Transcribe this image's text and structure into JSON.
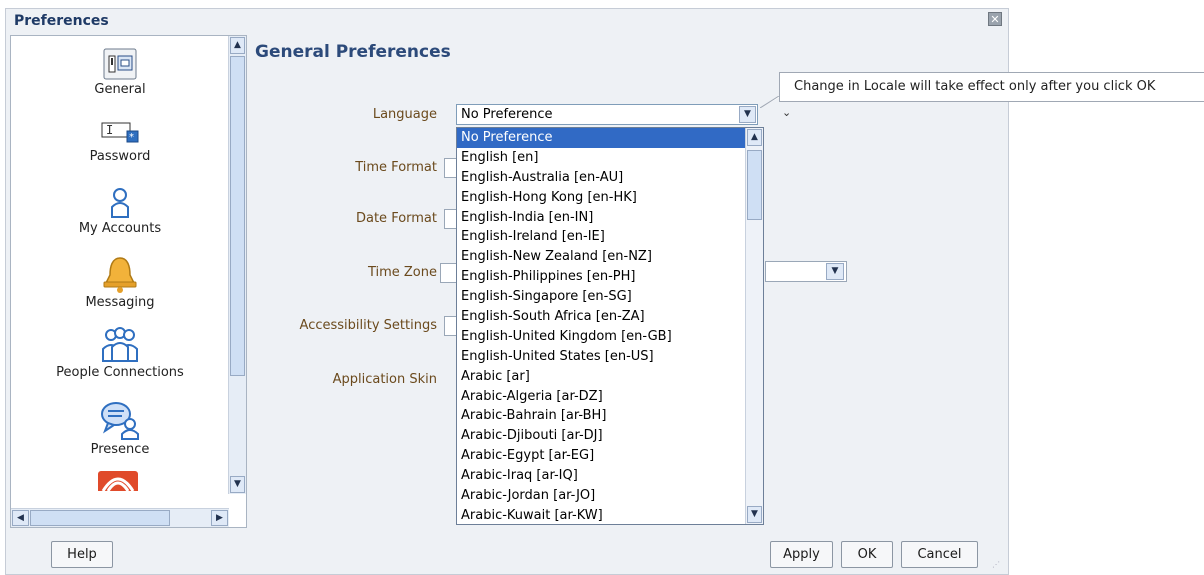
{
  "dialog": {
    "title": "Preferences"
  },
  "nav": {
    "items": [
      {
        "label": "General",
        "icon": "general-settings-icon"
      },
      {
        "label": "Password",
        "icon": "password-icon"
      },
      {
        "label": "My Accounts",
        "icon": "user-accounts-icon"
      },
      {
        "label": "Messaging",
        "icon": "bell-icon"
      },
      {
        "label": "People Connections",
        "icon": "people-connections-icon"
      },
      {
        "label": "Presence",
        "icon": "presence-icon"
      }
    ]
  },
  "main": {
    "title": "General Preferences",
    "fields": [
      {
        "label": "Language",
        "value": "No Preference"
      },
      {
        "label": "Time Format"
      },
      {
        "label": "Date Format"
      },
      {
        "label": "Time Zone"
      },
      {
        "label": "Accessibility Settings"
      },
      {
        "label": "Application Skin"
      }
    ]
  },
  "tooltip": {
    "text": "Change in Locale will take effect only after you click OK"
  },
  "dropdown": {
    "selected": "No Preference",
    "options": [
      "No Preference",
      "English [en]",
      "English-Australia [en-AU]",
      "English-Hong Kong [en-HK]",
      "English-India [en-IN]",
      "English-Ireland [en-IE]",
      "English-New Zealand [en-NZ]",
      "English-Philippines [en-PH]",
      "English-Singapore [en-SG]",
      "English-South Africa [en-ZA]",
      "English-United Kingdom [en-GB]",
      "English-United States [en-US]",
      "Arabic [ar]",
      "Arabic-Algeria [ar-DZ]",
      "Arabic-Bahrain [ar-BH]",
      "Arabic-Djibouti [ar-DJ]",
      "Arabic-Egypt [ar-EG]",
      "Arabic-Iraq [ar-IQ]",
      "Arabic-Jordan [ar-JO]",
      "Arabic-Kuwait [ar-KW]"
    ]
  },
  "buttons": {
    "help": "Help",
    "apply": "Apply",
    "ok": "OK",
    "cancel": "Cancel"
  },
  "colors": {
    "selected": "#316ac5",
    "label": "#6b4a1d",
    "title": "#2c4a7a"
  }
}
